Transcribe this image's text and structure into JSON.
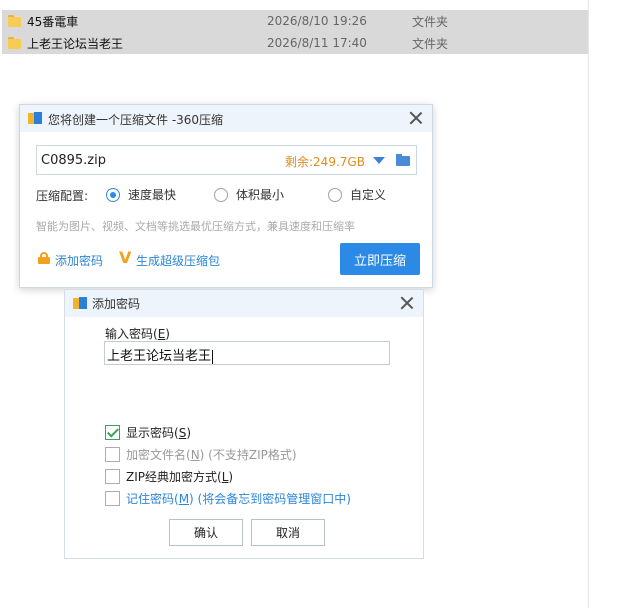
{
  "explorer": {
    "files": [
      {
        "name": "45番電車",
        "date": "2026/8/10 19:26",
        "type": "文件夹"
      },
      {
        "name": "上老王论坛当老王",
        "date": "2026/8/11 17:40",
        "type": "文件夹"
      }
    ]
  },
  "compress_dialog": {
    "title": "您将创建一个压缩文件 -360压缩",
    "filename": "C0895.zip",
    "free_space": "剩余:249.7GB",
    "config_label": "压缩配置:",
    "options": [
      "速度最快",
      "体积最小",
      "自定义"
    ],
    "selected_option": "速度最快",
    "hint": "智能为图片、视频、文档等挑选最优压缩方式，兼具速度和压缩率",
    "add_password_link": "添加密码",
    "super_package_link": "生成超级压缩包",
    "compress_button": "立即压缩",
    "colors": {
      "accent": "#2b8ae6",
      "space": "#e08a1e",
      "title_bar": "#eef4fb"
    }
  },
  "password_dialog": {
    "title": "添加密码",
    "input_label_prefix": "输入密码(",
    "input_label_key": "E",
    "input_label_suffix": ")",
    "password_value": "上老王论坛当老王",
    "checkboxes": [
      {
        "prefix": "显示密码(",
        "key": "S",
        "suffix": ")",
        "checked": true
      },
      {
        "prefix": "加密文件名(",
        "key": "N",
        "suffix": ") (不支持ZIP格式)",
        "checked": false
      },
      {
        "prefix": "ZIP经典加密方式(",
        "key": "L",
        "suffix": ")",
        "checked": false
      },
      {
        "prefix": "记住密码(",
        "key": "M",
        "suffix": ") (将会备忘到密码管理窗口中)",
        "checked": false
      }
    ],
    "ok_button": "确认",
    "cancel_button": "取消"
  }
}
